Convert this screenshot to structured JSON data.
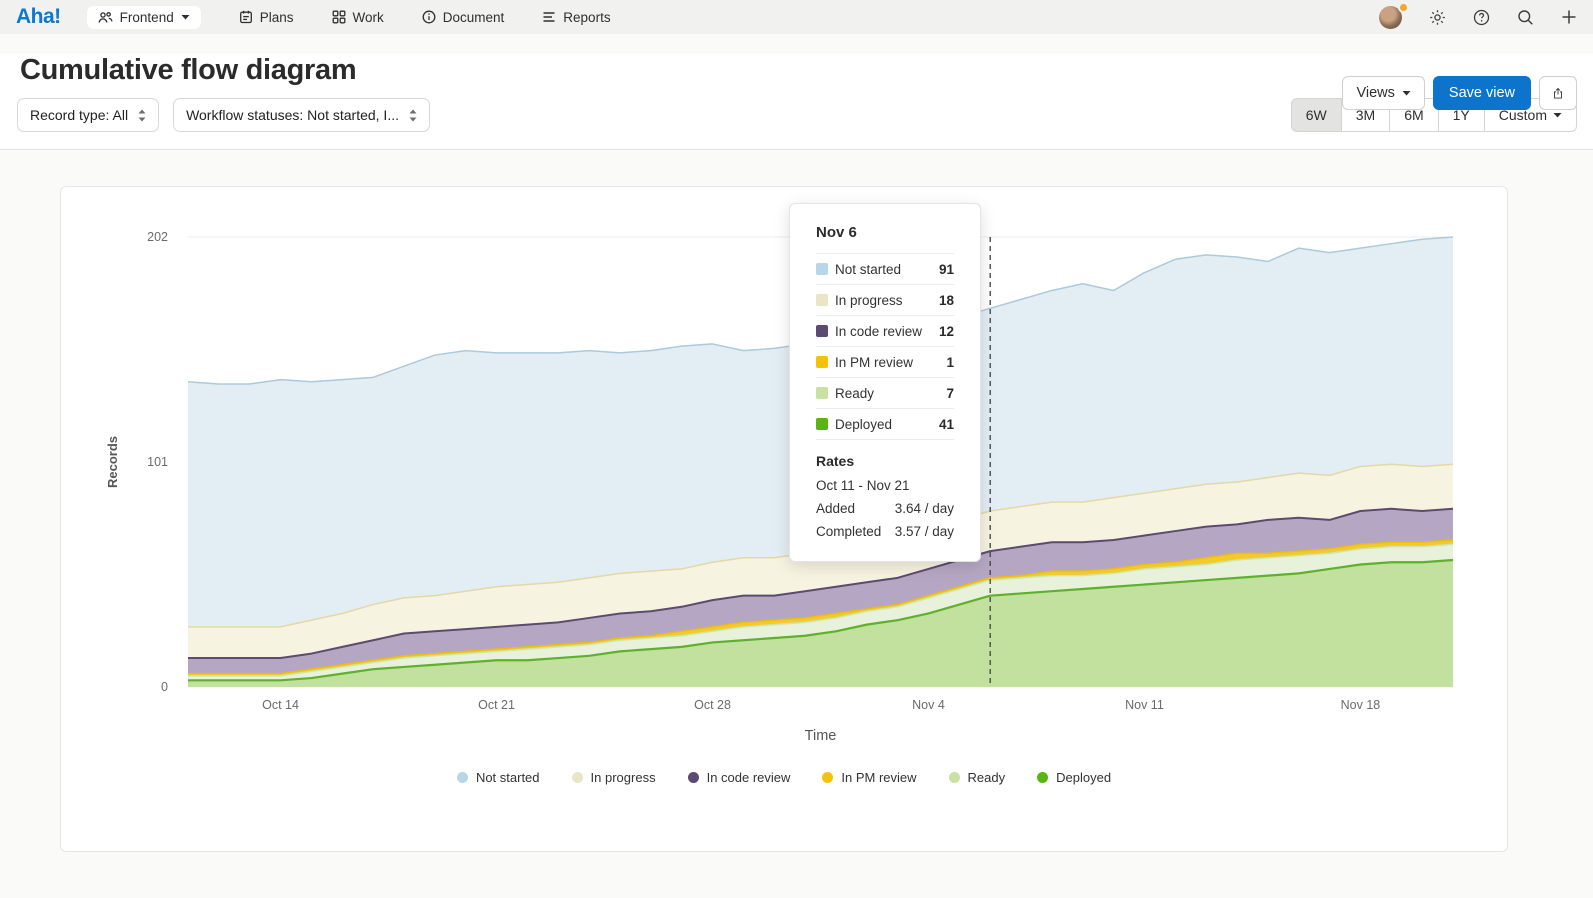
{
  "navbar": {
    "logo": "Aha!",
    "workspace_label": "Frontend",
    "items": [
      {
        "label": "Plans",
        "icon": "clipboard-icon"
      },
      {
        "label": "Work",
        "icon": "grid-icon"
      },
      {
        "label": "Document",
        "icon": "info-circle-icon"
      },
      {
        "label": "Reports",
        "icon": "report-lines-icon"
      }
    ],
    "notification_color": "#f7a531"
  },
  "header": {
    "title": "Cumulative flow diagram",
    "views_button": "Views",
    "save_button": "Save view"
  },
  "filters": {
    "record_type": "Record type: All",
    "workflow_statuses": "Workflow statuses: Not started, I...",
    "ranges": [
      "6W",
      "3M",
      "6M",
      "1Y",
      "Custom"
    ],
    "selected_range": "6W"
  },
  "tooltip": {
    "title": "Nov 6",
    "rows": [
      {
        "label": "Not started",
        "value": "91",
        "color": "#b7d7e8"
      },
      {
        "label": "In progress",
        "value": "18",
        "color": "#eae5c6"
      },
      {
        "label": "In code review",
        "value": "12",
        "color": "#5d4a71"
      },
      {
        "label": "In PM review",
        "value": "1",
        "color": "#f4c20d"
      },
      {
        "label": "Ready",
        "value": "7",
        "color": "#c8e2a4"
      },
      {
        "label": "Deployed",
        "value": "41",
        "color": "#58b514"
      }
    ],
    "rates": {
      "heading": "Rates",
      "range": "Oct 11 - Nov 21",
      "added_label": "Added",
      "added_value": "3.64 / day",
      "completed_label": "Completed",
      "completed_value": "3.57 / day"
    }
  },
  "chart_data": {
    "type": "area",
    "stacked": true,
    "xlabel": "Time",
    "ylabel": "Records",
    "yticks": [
      0,
      101,
      202
    ],
    "ylim": [
      0,
      202
    ],
    "x": [
      "Oct 11",
      "Oct 12",
      "Oct 13",
      "Oct 14",
      "Oct 15",
      "Oct 16",
      "Oct 17",
      "Oct 18",
      "Oct 19",
      "Oct 20",
      "Oct 21",
      "Oct 22",
      "Oct 23",
      "Oct 24",
      "Oct 25",
      "Oct 26",
      "Oct 27",
      "Oct 28",
      "Oct 29",
      "Oct 30",
      "Oct 31",
      "Nov 1",
      "Nov 2",
      "Nov 3",
      "Nov 4",
      "Nov 5",
      "Nov 6",
      "Nov 7",
      "Nov 8",
      "Nov 9",
      "Nov 10",
      "Nov 11",
      "Nov 12",
      "Nov 13",
      "Nov 14",
      "Nov 15",
      "Nov 16",
      "Nov 17",
      "Nov 18",
      "Nov 19",
      "Nov 20",
      "Nov 21"
    ],
    "xtick_indices": [
      3,
      10,
      17,
      24,
      31,
      38
    ],
    "marker_line": {
      "label": "Nov 6",
      "index": 26
    },
    "series": [
      {
        "name": "Deployed",
        "fill": "#c2e09e",
        "stroke": "#5fb02b",
        "stroke_width": 2.2,
        "values": [
          3,
          3,
          3,
          3,
          4,
          6,
          8,
          9,
          10,
          11,
          12,
          12,
          13,
          14,
          16,
          17,
          18,
          20,
          21,
          22,
          23,
          25,
          28,
          30,
          33,
          37,
          41,
          42,
          43,
          44,
          45,
          46,
          47,
          48,
          49,
          50,
          51,
          53,
          55,
          56,
          56,
          57
        ]
      },
      {
        "name": "Ready",
        "fill": "#e8f2da",
        "stroke": "#cde6ae",
        "stroke_width": 1.5,
        "values": [
          2,
          2,
          2,
          2,
          3,
          3,
          3,
          4,
          4,
          4,
          4,
          5,
          5,
          5,
          5,
          5,
          5,
          5,
          6,
          6,
          6,
          6,
          6,
          6,
          7,
          7,
          7,
          7,
          7,
          6,
          6,
          7,
          7,
          7,
          8,
          8,
          8,
          7,
          7,
          7,
          7,
          7
        ]
      },
      {
        "name": "In PM review",
        "fill": "#f2ca30",
        "stroke": "#edbf0c",
        "stroke_width": 1.5,
        "values": [
          1,
          1,
          1,
          1,
          1,
          1,
          1,
          1,
          1,
          1,
          1,
          1,
          1,
          1,
          1,
          1,
          2,
          2,
          2,
          2,
          2,
          2,
          1,
          1,
          1,
          1,
          1,
          1,
          2,
          2,
          2,
          2,
          2,
          3,
          3,
          2,
          2,
          2,
          2,
          2,
          2,
          2
        ]
      },
      {
        "name": "In code review",
        "fill": "#b5a7c3",
        "stroke": "#5d4a71",
        "stroke_width": 2,
        "values": [
          7,
          7,
          7,
          7,
          7,
          8,
          9,
          10,
          10,
          10,
          10,
          10,
          10,
          11,
          11,
          11,
          11,
          12,
          12,
          11,
          12,
          12,
          12,
          12,
          12,
          12,
          12,
          13,
          13,
          13,
          13,
          13,
          14,
          14,
          13,
          15,
          15,
          13,
          15,
          15,
          14,
          14
        ]
      },
      {
        "name": "In progress",
        "fill": "#f7f3e1",
        "stroke": "#e3d9a5",
        "stroke_width": 1.5,
        "values": [
          14,
          14,
          14,
          14,
          15,
          15,
          16,
          16,
          16,
          17,
          18,
          18,
          18,
          18,
          18,
          18,
          17,
          17,
          17,
          17,
          17,
          17,
          17,
          17,
          18,
          18,
          18,
          18,
          18,
          18,
          19,
          19,
          19,
          19,
          19,
          19,
          20,
          20,
          20,
          20,
          20,
          20
        ]
      },
      {
        "name": "Not started",
        "fill": "#e3edf4",
        "stroke": "#accadb",
        "stroke_width": 1.5,
        "values": [
          110,
          109,
          109,
          111,
          107,
          105,
          102,
          104,
          108,
          108,
          105,
          104,
          103,
          102,
          99,
          99,
          100,
          98,
          93,
          94,
          94,
          94,
          93,
          91,
          85,
          91,
          91,
          93,
          95,
          98,
          93,
          99,
          103,
          103,
          101,
          97,
          101,
          100,
          98,
          99,
          102,
          102
        ]
      }
    ],
    "legend": [
      {
        "label": "Not started",
        "color": "#b7d7e8"
      },
      {
        "label": "In progress",
        "color": "#eae5c6"
      },
      {
        "label": "In code review",
        "color": "#5d4a71"
      },
      {
        "label": "In PM review",
        "color": "#f4c20d"
      },
      {
        "label": "Ready",
        "color": "#c8e2a4"
      },
      {
        "label": "Deployed",
        "color": "#58b514"
      }
    ]
  }
}
